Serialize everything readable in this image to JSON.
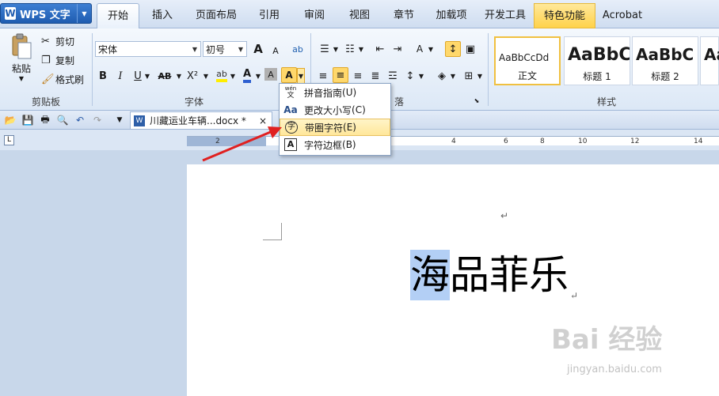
{
  "app": {
    "button_label": "WPS 文字",
    "logo": "W"
  },
  "tabs": [
    {
      "label": "开始",
      "active": true
    },
    {
      "label": "插入"
    },
    {
      "label": "页面布局"
    },
    {
      "label": "引用"
    },
    {
      "label": "审阅"
    },
    {
      "label": "视图"
    },
    {
      "label": "章节"
    },
    {
      "label": "加载项"
    },
    {
      "label": "开发工具"
    },
    {
      "label": "特色功能",
      "special": true
    },
    {
      "label": "Acrobat"
    }
  ],
  "clipboard": {
    "paste": "粘贴",
    "cut": "剪切",
    "copy": "复制",
    "format_painter": "格式刷",
    "group": "剪贴板"
  },
  "font": {
    "name": "宋体",
    "size": "初号",
    "group": "字体",
    "bold": "B",
    "italic": "I",
    "underline": "U",
    "strike": "AB",
    "superscript": "X²",
    "color_a": "A",
    "grow": "A",
    "shrink": "A"
  },
  "paragraph": {
    "group_partial": "落"
  },
  "styles": {
    "group": "样式",
    "items": [
      {
        "sample": "AaBbCcDd",
        "name": "正文"
      },
      {
        "sample": "AaBbC",
        "name": "标题 1"
      },
      {
        "sample": "AaBbC",
        "name": "标题 2"
      },
      {
        "sample": "AaB",
        "name": ""
      }
    ]
  },
  "dropdown": {
    "items": [
      {
        "label": "拼音指南",
        "key": "(U)",
        "icon": "wén"
      },
      {
        "label": "更改大小写",
        "key": "(C)",
        "icon": "Aa"
      },
      {
        "label": "带圈字符",
        "key": "(E)",
        "icon": "字"
      },
      {
        "label": "字符边框",
        "key": "(B)",
        "icon": "A"
      }
    ]
  },
  "document_tab": {
    "name": "川藏运业车辆...docx *",
    "close": "×"
  },
  "ruler": {
    "ticks": [
      "2",
      "4",
      "6",
      "8",
      "10",
      "12",
      "14"
    ]
  },
  "document": {
    "selected_char": "海",
    "rest_text": "品菲乐",
    "para_mark": "↵"
  },
  "watermark": {
    "brand": "Bai  经验",
    "url": "jingyan.baidu.com"
  }
}
